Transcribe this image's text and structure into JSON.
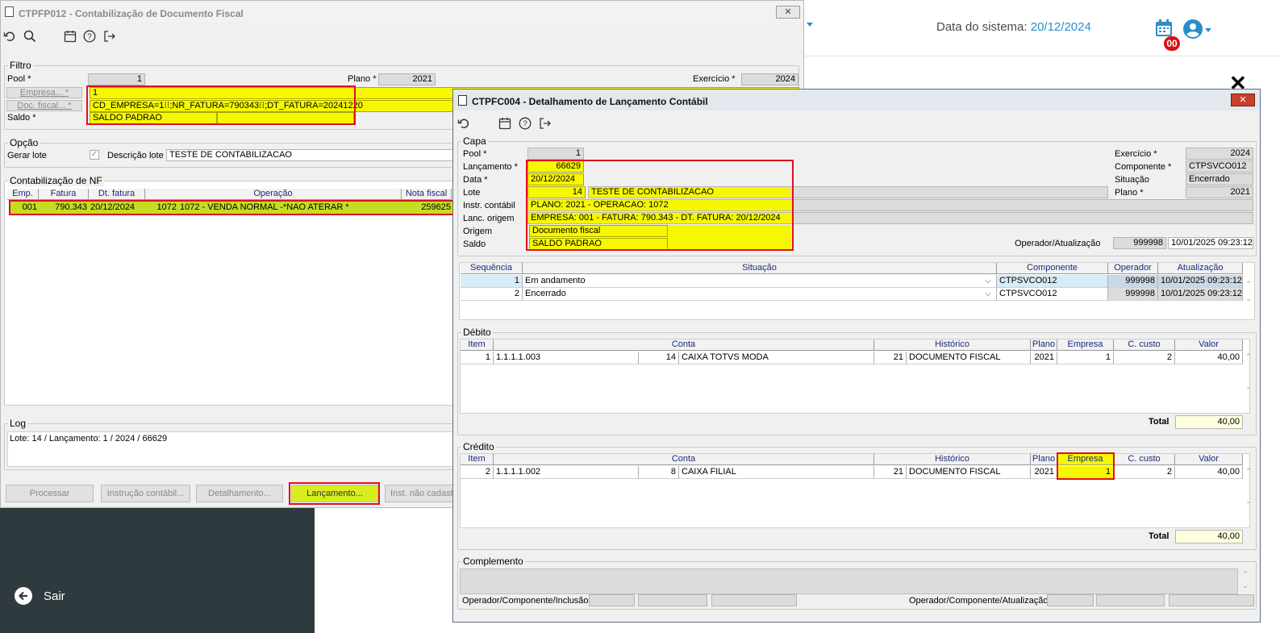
{
  "sistema": {
    "data_label": "Data do sistema:",
    "data_value": "20/12/2024",
    "badge": "00",
    "sair": "Sair"
  },
  "w1": {
    "title": "CTPFP012 - Contabilização de Documento Fiscal",
    "filtro": {
      "title": "Filtro",
      "pool_label": "Pool *",
      "pool": "1",
      "plano_label": "Plano *",
      "plano": "2021",
      "exercicio_label": "Exercício *",
      "exercicio": "2024",
      "empresa_btn": "Empresa... *",
      "empresa": "1",
      "doc_btn": "Doc. fiscal... *",
      "doc": "CD_EMPRESA=1⁝⁝;NR_FATURA=790343⁝⁝;DT_FATURA=20241220",
      "saldo_label": "Saldo *",
      "saldo": "SALDO PADRAO"
    },
    "opcao": {
      "title": "Opção",
      "gerar_lote": "Gerar lote",
      "desc_label": "Descrição lote",
      "desc": "TESTE DE CONTABILIZACAO"
    },
    "nf": {
      "title": "Contabilização de NF",
      "headers": [
        "Emp.",
        "Fatura",
        "Dt. fatura",
        "Operação",
        "Nota fiscal"
      ],
      "row": {
        "emp": "001",
        "fatura": "790.343",
        "dt": "20/12/2024",
        "op_code": "1072",
        "op": "1072 - VENDA NORMAL -*NAO ATERAR *",
        "nota": "259625"
      }
    },
    "log": {
      "title": "Log",
      "text": "Lote: 14 / Lançamento: 1 / 2024 / 66629"
    },
    "buttons": {
      "processar": "Processar",
      "instrucao": "Instrução contábil...",
      "detalhamento": "Detalhamento...",
      "lancamento": "Lançamento...",
      "inst_nao": "Inst. não cadastr"
    }
  },
  "w2": {
    "title": "CTPFC004 - Detalhamento de Lançamento Contábil",
    "capa": {
      "title": "Capa",
      "pool_label": "Pool *",
      "pool": "1",
      "lanc_label": "Lançamento *",
      "lanc": "66629",
      "data_label": "Data *",
      "data": "20/12/2024",
      "lote_label": "Lote",
      "lote_num": "14",
      "lote_desc": "TESTE DE CONTABILIZACAO",
      "instr_label": "Instr. contábil",
      "instr": "PLANO: 2021 - OPERACAO: 1072",
      "lorig_label": "Lanc. origem",
      "lorig": "EMPRESA: 001 - FATURA: 790.343 - DT. FATURA: 20/12/2024",
      "origem_label": "Origem",
      "origem": "Documento fiscal",
      "saldo_label": "Saldo",
      "saldo": "SALDO PADRAO",
      "exerc_label": "Exercício *",
      "exerc": "2024",
      "comp_label": "Componente *",
      "comp": "CTPSVCO012",
      "sit_label": "Situação",
      "sit": "Encerrado",
      "plano_label": "Plano *",
      "plano": "2021",
      "opat_label": "Operador/Atualização",
      "op": "999998",
      "at": "10/01/2025 09:23:12"
    },
    "seq": {
      "headers": [
        "Sequência",
        "Situação",
        "Componente",
        "Operador",
        "Atualização"
      ],
      "rows": [
        {
          "seq": "1",
          "sit": "Em andamento",
          "comp": "CTPSVCO012",
          "op": "999998",
          "at": "10/01/2025 09:23:12"
        },
        {
          "seq": "2",
          "sit": "Encerrado",
          "comp": "CTPSVCO012",
          "op": "999998",
          "at": "10/01/2025 09:23:12"
        }
      ]
    },
    "debito": {
      "title": "Débito",
      "headers": [
        "Item",
        "Conta",
        "Histórico",
        "Plano",
        "Empresa",
        "C. custo",
        "Valor"
      ],
      "row": {
        "item": "1",
        "conta": "1.1.1.1.003",
        "conta_num": "14",
        "conta_desc": "CAIXA TOTVS MODA",
        "hist_num": "21",
        "hist": "DOCUMENTO FISCAL",
        "plano": "2021",
        "empresa": "1",
        "custo": "2",
        "valor": "40,00"
      },
      "total_label": "Total",
      "total": "40,00"
    },
    "credito": {
      "title": "Crédito",
      "headers": [
        "Item",
        "Conta",
        "Histórico",
        "Plano",
        "Empresa",
        "C. custo",
        "Valor"
      ],
      "row": {
        "item": "2",
        "conta": "1.1.1.1.002",
        "conta_num": "8",
        "conta_desc": "CAIXA FILIAL",
        "hist_num": "21",
        "hist": "DOCUMENTO FISCAL",
        "plano": "2021",
        "empresa": "1",
        "custo": "2",
        "valor": "40,00"
      },
      "total_label": "Total",
      "total": "40,00"
    },
    "complemento": {
      "title": "Complemento",
      "inclusao_label": "Operador/Componente/Inclusão",
      "atualizacao_label": "Operador/Componente/Atualização"
    }
  }
}
